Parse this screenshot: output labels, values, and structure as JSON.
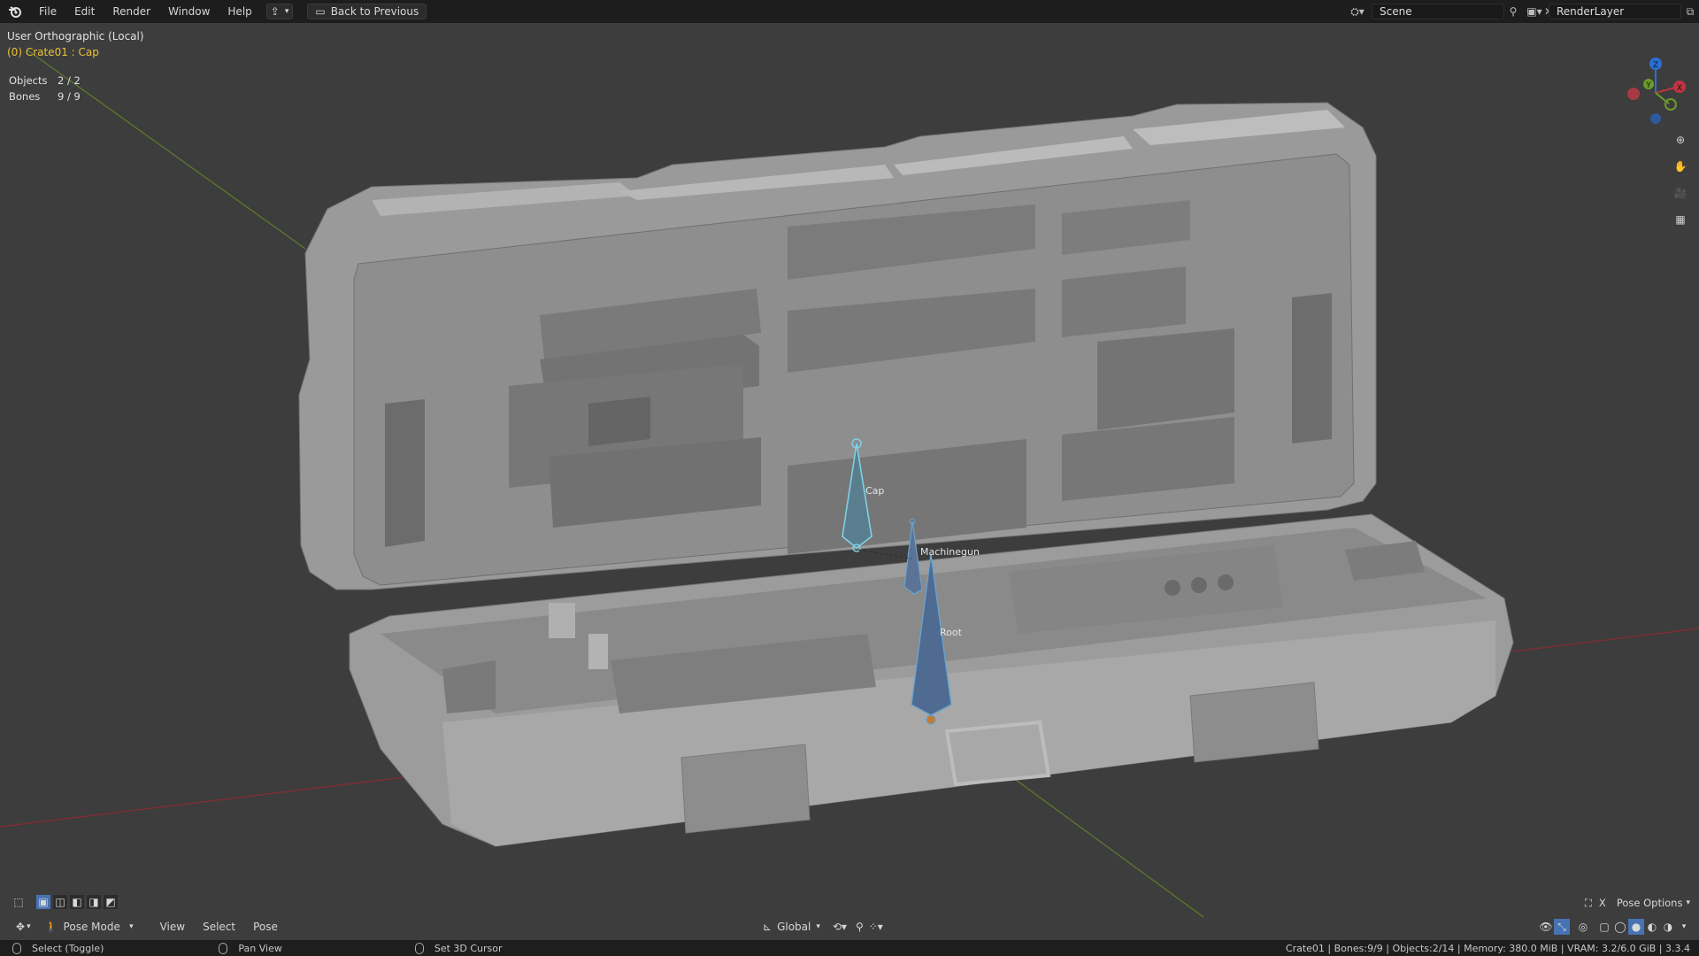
{
  "topbar": {
    "menus": [
      "File",
      "Edit",
      "Render",
      "Window",
      "Help"
    ],
    "back_button": "Back to Previous",
    "scene_name": "Scene",
    "view_layer_name": "RenderLayer"
  },
  "viewport": {
    "view_name": "User Orthographic (Local)",
    "active_object": "(0) Crate01 : Cap",
    "stats": [
      {
        "label": "Objects",
        "value": "2 / 2"
      },
      {
        "label": "Bones",
        "value": "9 / 9"
      }
    ],
    "bone_labels": [
      "Cap",
      "Machinegun",
      "Root"
    ],
    "gizmo_axes": {
      "z": "Z",
      "y": "Y",
      "x": "X"
    }
  },
  "header_bottom": {
    "mode": "Pose Mode",
    "menus": [
      "View",
      "Select",
      "Pose"
    ],
    "orientation": "Global",
    "pose_options": "Pose Options",
    "x_mirror": "X"
  },
  "statusbar": {
    "hints": [
      {
        "label": "Select (Toggle)"
      },
      {
        "label": "Pan View"
      },
      {
        "label": "Set 3D Cursor"
      }
    ],
    "info": "Crate01 | Bones:9/9 | Objects:2/14 | Memory: 380.0 MiB | VRAM: 3.2/6.0 GiB | 3.3.4"
  },
  "colors": {
    "x_axis": "#c0343f",
    "y_axis": "#6a9b2b",
    "z_axis": "#2b6fd6",
    "active_text": "#e8c23a",
    "bone_fill": "#5a7ea2",
    "bone_selected": "#6ab3d4"
  }
}
